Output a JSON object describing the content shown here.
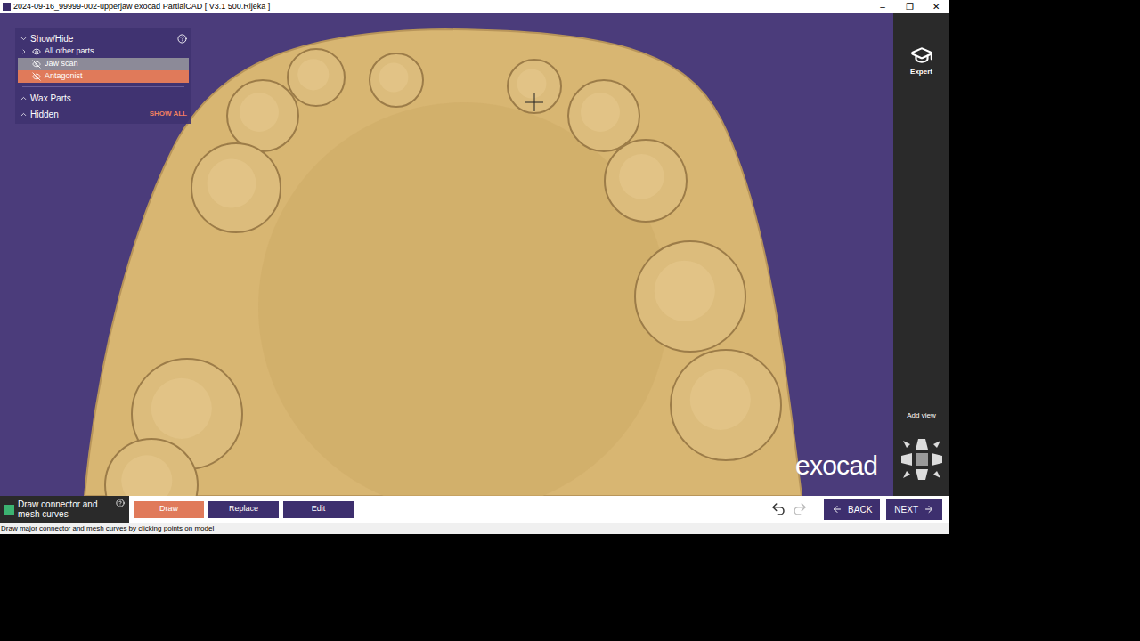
{
  "window": {
    "title": "2024-09-16_99999-002-upperjaw exocad PartialCAD [ V3.1 500.Rijeka ]",
    "controls": [
      "–",
      "❐",
      "✕"
    ]
  },
  "show_hide_panel": {
    "title": "Show/Hide",
    "expanded": true,
    "items": [
      {
        "label": "All other parts",
        "visible": true,
        "selected": false,
        "expanded": false,
        "color": "#4a3a7c"
      },
      {
        "label": "Jaw scan",
        "visible": false,
        "selected": true,
        "expanded": false,
        "color": "#8c8a98"
      },
      {
        "label": "Antagonist",
        "visible": false,
        "selected": true,
        "expanded": false,
        "color": "#e07a5a"
      }
    ],
    "sections": [
      {
        "label": "Wax Parts",
        "expanded": false,
        "action": ""
      },
      {
        "label": "Hidden",
        "expanded": false,
        "action": "SHOW ALL"
      }
    ]
  },
  "sidebar": {
    "mode": "Expert",
    "add_view": "Add view"
  },
  "watermark": "exocad",
  "toolbar": {
    "step": "Draw connector and mesh curves",
    "tools": [
      {
        "label": "Draw",
        "selected": true
      },
      {
        "label": "Replace",
        "selected": false
      },
      {
        "label": "Edit",
        "selected": false
      }
    ],
    "undo_enabled": true,
    "redo_enabled": false,
    "back": "BACK",
    "next": "NEXT"
  },
  "status_bar": "Draw major connector and mesh curves by clicking points on model"
}
